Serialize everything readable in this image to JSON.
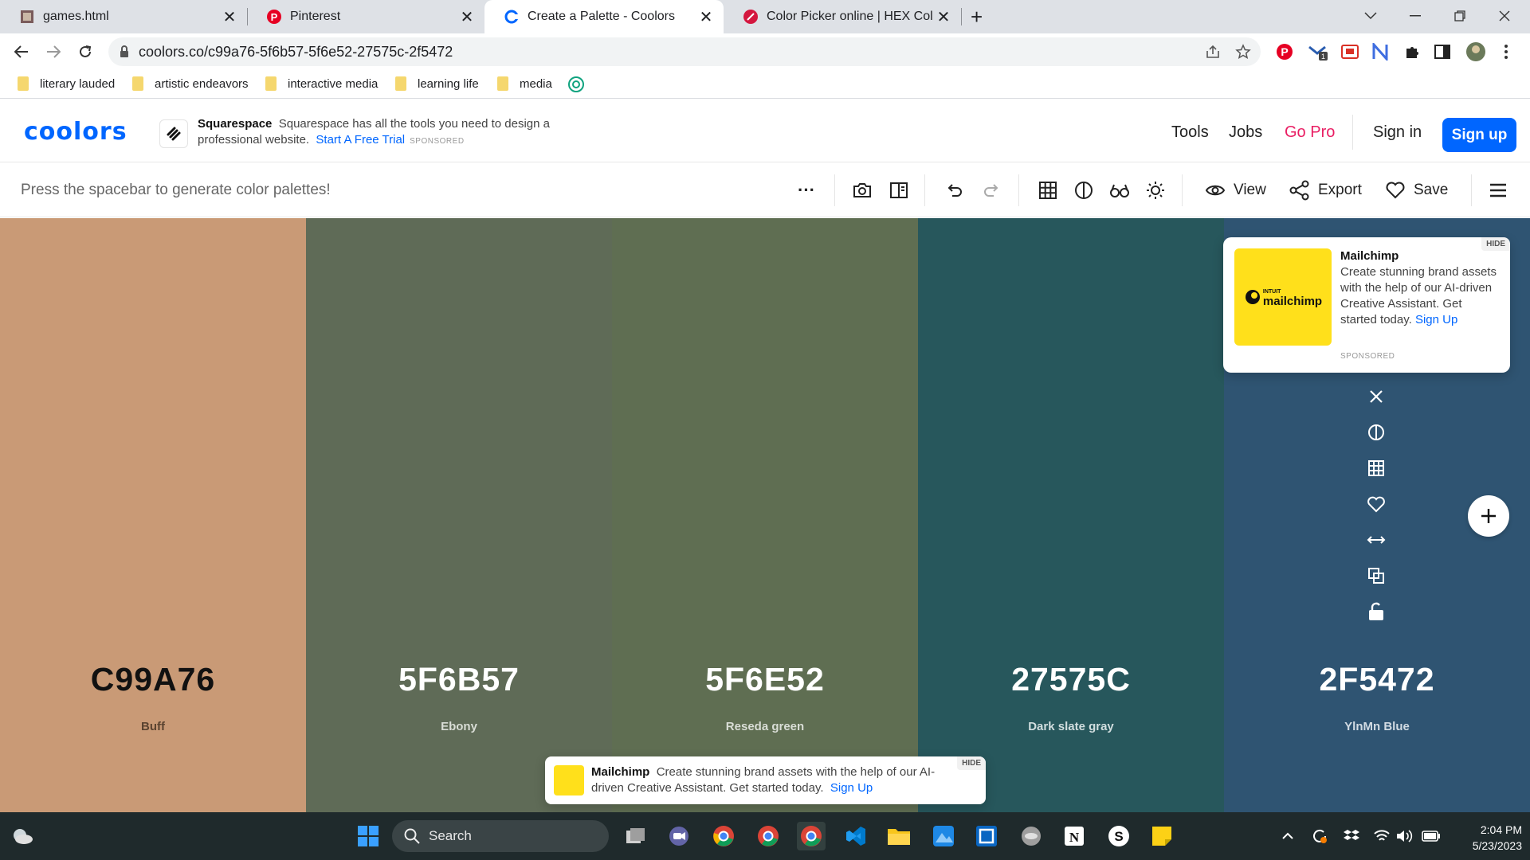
{
  "browser": {
    "tabs": [
      {
        "title": "games.html",
        "icon": "file-icon"
      },
      {
        "title": "Pinterest",
        "icon": "pinterest-icon"
      },
      {
        "title": "Create a Palette - Coolors",
        "icon": "coolors-icon",
        "active": true
      },
      {
        "title": "Color Picker online | HEX Col",
        "icon": "color-picker-icon"
      }
    ],
    "new_tab_label": "+",
    "url": "coolors.co/c99a76-5f6b57-5f6e52-27575c-2f5472",
    "bookmarks": [
      "literary lauded",
      "artistic endeavors",
      "interactive media",
      "learning life",
      "media"
    ]
  },
  "site": {
    "logo": "coolors",
    "ad": {
      "brand": "Squarespace",
      "text": "Squarespace has all the tools you need to design a professional website.",
      "link": "Start A Free Trial",
      "sponsored": "SPONSORED"
    },
    "nav": {
      "tools": "Tools",
      "jobs": "Jobs",
      "gopro": "Go Pro",
      "signin": "Sign in",
      "signup": "Sign up"
    },
    "hint": "Press the spacebar to generate color palettes!",
    "toolbar": {
      "more": "···",
      "view": "View",
      "export": "Export",
      "save": "Save"
    }
  },
  "palette": {
    "colors": [
      {
        "hex": "C99A76",
        "name": "Buff",
        "bg": "#c99a76",
        "fg": "#111111",
        "sub": "#5a4330"
      },
      {
        "hex": "5F6B57",
        "name": "Ebony",
        "bg": "#5f6b57",
        "fg": "#ffffff",
        "sub": "#d9ddd6"
      },
      {
        "hex": "5F6E52",
        "name": "Reseda green",
        "bg": "#5f6e52",
        "fg": "#ffffff",
        "sub": "#d9ddd6"
      },
      {
        "hex": "27575C",
        "name": "Dark slate gray",
        "bg": "#27575c",
        "fg": "#ffffff",
        "sub": "#d2dedf"
      },
      {
        "hex": "2F5472",
        "name": "YlnMn Blue",
        "bg": "#2f5472",
        "fg": "#ffffff",
        "sub": "#d2dbe3"
      }
    ]
  },
  "mailchimp_card": {
    "brand": "Mailchimp",
    "text": "Create stunning brand assets with the help of our AI-driven Creative Assistant. Get started today.",
    "link": "Sign Up",
    "hide": "HIDE",
    "sponsored": "SPONSORED",
    "logo_text": "mailchimp",
    "logo_small": "INTUIT"
  },
  "bottom_ad": {
    "brand": "Mailchimp",
    "text": "Create stunning brand assets with the help of our AI-driven Creative Assistant. Get started today.",
    "link": "Sign Up",
    "hide": "HIDE"
  },
  "taskbar": {
    "search": "Search",
    "time": "2:04 PM",
    "date": "5/23/2023"
  }
}
